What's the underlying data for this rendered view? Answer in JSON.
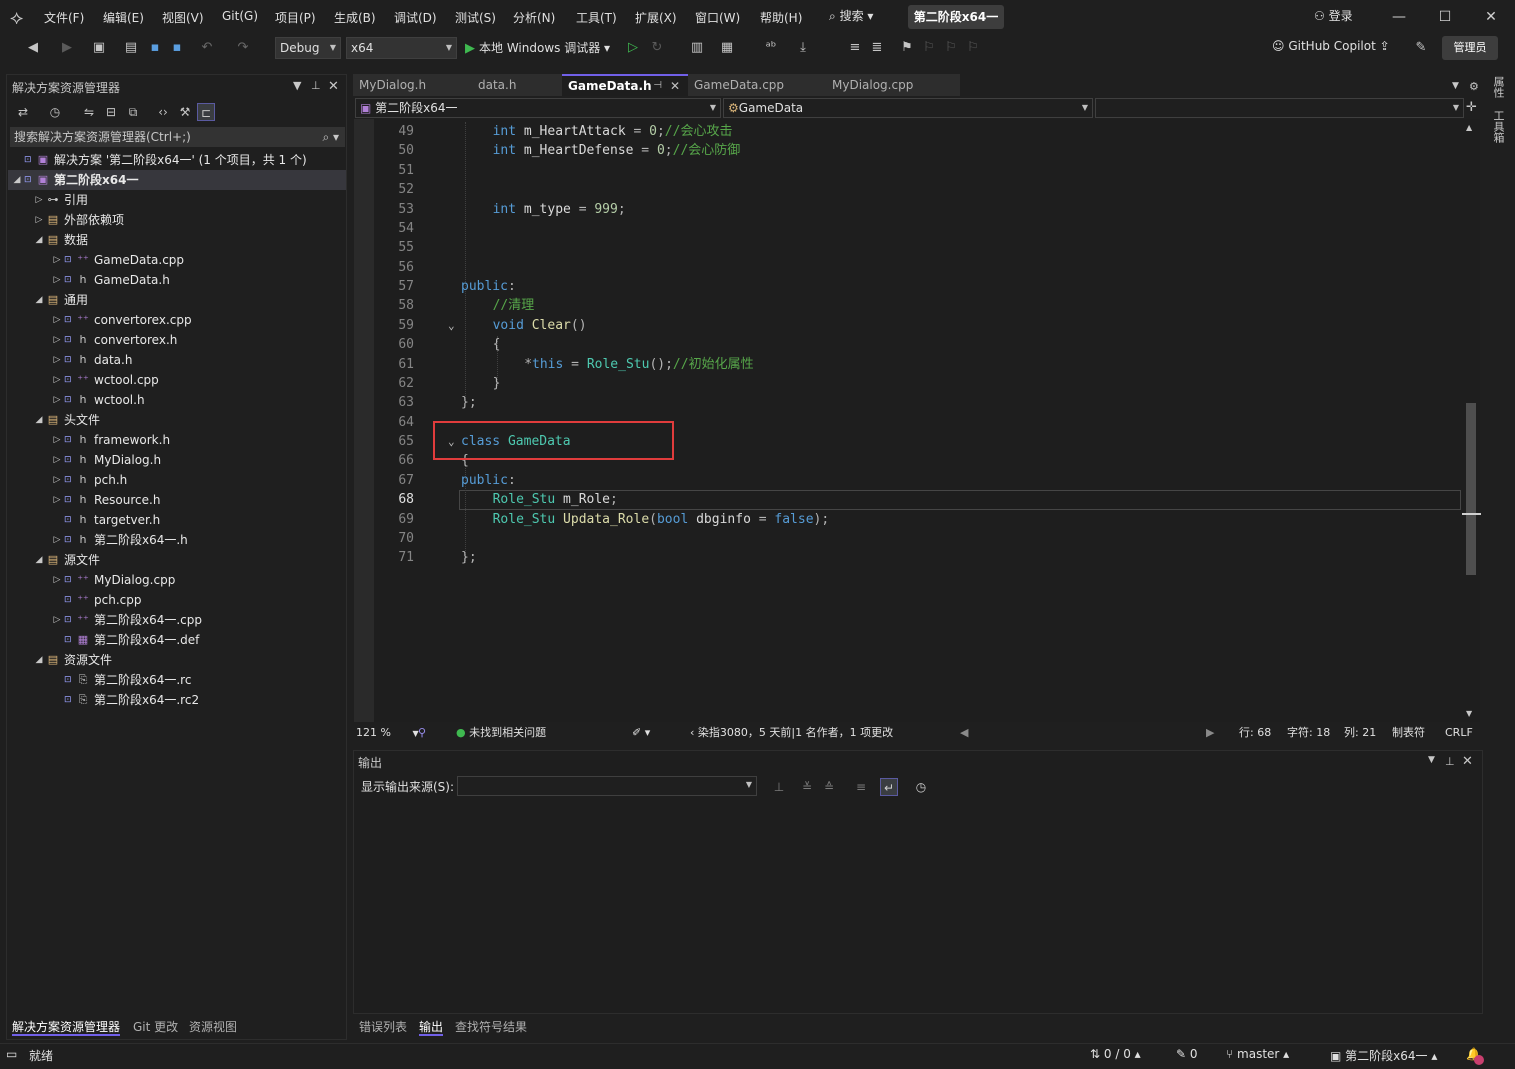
{
  "menu": [
    "文件(F)",
    "编辑(E)",
    "视图(V)",
    "Git(G)",
    "项目(P)",
    "生成(B)",
    "调试(D)",
    "测试(S)",
    "分析(N)",
    "工具(T)",
    "扩展(X)",
    "窗口(W)",
    "帮助(H)"
  ],
  "search_label": "搜索",
  "solution_name": "第二阶段x64一",
  "login_label": "登录",
  "toolbar": {
    "config": "Debug",
    "platform": "x64",
    "run_label": "本地 Windows 调试器",
    "copilot": "GitHub Copilot",
    "admin": "管理员"
  },
  "solution_explorer": {
    "title": "解决方案资源管理器",
    "search_placeholder": "搜索解决方案资源管理器(Ctrl+;)",
    "tree": [
      {
        "label": "解决方案 '第二阶段x64一' (1 个项目，共 1 个)",
        "kind": "solution"
      },
      {
        "label": "第二阶段x64一",
        "kind": "project"
      },
      {
        "label": "引用",
        "kind": "ref"
      },
      {
        "label": "外部依赖项",
        "kind": "folder"
      },
      {
        "label": "数据",
        "kind": "folder"
      },
      {
        "label": "GameData.cpp",
        "kind": "cpp"
      },
      {
        "label": "GameData.h",
        "kind": "h"
      },
      {
        "label": "通用",
        "kind": "folder"
      },
      {
        "label": "convertorex.cpp",
        "kind": "cpp"
      },
      {
        "label": "convertorex.h",
        "kind": "h"
      },
      {
        "label": "data.h",
        "kind": "h"
      },
      {
        "label": "wctool.cpp",
        "kind": "cpp"
      },
      {
        "label": "wctool.h",
        "kind": "h"
      },
      {
        "label": "头文件",
        "kind": "folder"
      },
      {
        "label": "framework.h",
        "kind": "h"
      },
      {
        "label": "MyDialog.h",
        "kind": "h"
      },
      {
        "label": "pch.h",
        "kind": "h"
      },
      {
        "label": "Resource.h",
        "kind": "h"
      },
      {
        "label": "targetver.h",
        "kind": "h"
      },
      {
        "label": "第二阶段x64一.h",
        "kind": "h"
      },
      {
        "label": "源文件",
        "kind": "folder"
      },
      {
        "label": "MyDialog.cpp",
        "kind": "cpp"
      },
      {
        "label": "pch.cpp",
        "kind": "cpp"
      },
      {
        "label": "第二阶段x64一.cpp",
        "kind": "cpp"
      },
      {
        "label": "第二阶段x64一.def",
        "kind": "def"
      },
      {
        "label": "资源文件",
        "kind": "folder"
      },
      {
        "label": "第二阶段x64一.rc",
        "kind": "rc"
      },
      {
        "label": "第二阶段x64一.rc2",
        "kind": "rc"
      }
    ],
    "bottom_tabs": [
      "解决方案资源管理器",
      "Git 更改",
      "资源视图"
    ]
  },
  "editor_tabs": [
    "MyDialog.h",
    "data.h",
    "GameData.h",
    "GameData.cpp",
    "MyDialog.cpp"
  ],
  "active_tab": "GameData.h",
  "nav": {
    "scope": "第二阶段x64一",
    "type": "GameData"
  },
  "code_lines": [
    {
      "n": "49",
      "text": "int m_HeartAttack = 0;//会心攻击"
    },
    {
      "n": "50",
      "text": "int m_HeartDefense = 0;//会心防御"
    },
    {
      "n": "51",
      "text": ""
    },
    {
      "n": "52",
      "text": ""
    },
    {
      "n": "53",
      "text": "int m_type = 999;"
    },
    {
      "n": "54",
      "text": ""
    },
    {
      "n": "55",
      "text": ""
    },
    {
      "n": "56",
      "text": ""
    },
    {
      "n": "57",
      "text": "public:"
    },
    {
      "n": "58",
      "text": "//清理"
    },
    {
      "n": "59",
      "text": "void Clear()"
    },
    {
      "n": "60",
      "text": "{"
    },
    {
      "n": "61",
      "text": "*this = Role_Stu();//初始化属性"
    },
    {
      "n": "62",
      "text": "}"
    },
    {
      "n": "63",
      "text": "};"
    },
    {
      "n": "64",
      "text": ""
    },
    {
      "n": "65",
      "text": "class GameData"
    },
    {
      "n": "66",
      "text": "{"
    },
    {
      "n": "67",
      "text": "public:"
    },
    {
      "n": "68",
      "text": "Role_Stu m_Role;"
    },
    {
      "n": "69",
      "text": "Role_Stu Updata_Role(bool dbginfo = false);"
    },
    {
      "n": "70",
      "text": ""
    },
    {
      "n": "71",
      "text": "};"
    }
  ],
  "editor_status": {
    "zoom": "121 %",
    "issues": "未找到相关问题",
    "blame": "染指3080，5 天前|1 名作者，1 项更改",
    "line": "行: 68",
    "char": "字符: 18",
    "col": "列: 21",
    "tabs": "制表符",
    "eol": "CRLF"
  },
  "output": {
    "title": "输出",
    "source_label": "显示输出来源(S):",
    "bottom_tabs": [
      "错误列表",
      "输出",
      "查找符号结果"
    ]
  },
  "right_tabs": [
    "属性",
    "工具箱"
  ],
  "statusbar": {
    "ready": "就绪",
    "sync": "0 / 0",
    "edits": "0",
    "branch": "master",
    "repo": "第二阶段x64一"
  },
  "colors": {
    "accent": "#7160e8",
    "highlight_box": "#e03c3c",
    "keyword": "#569cd6",
    "type": "#4ec9b0",
    "comment": "#57a64a"
  }
}
